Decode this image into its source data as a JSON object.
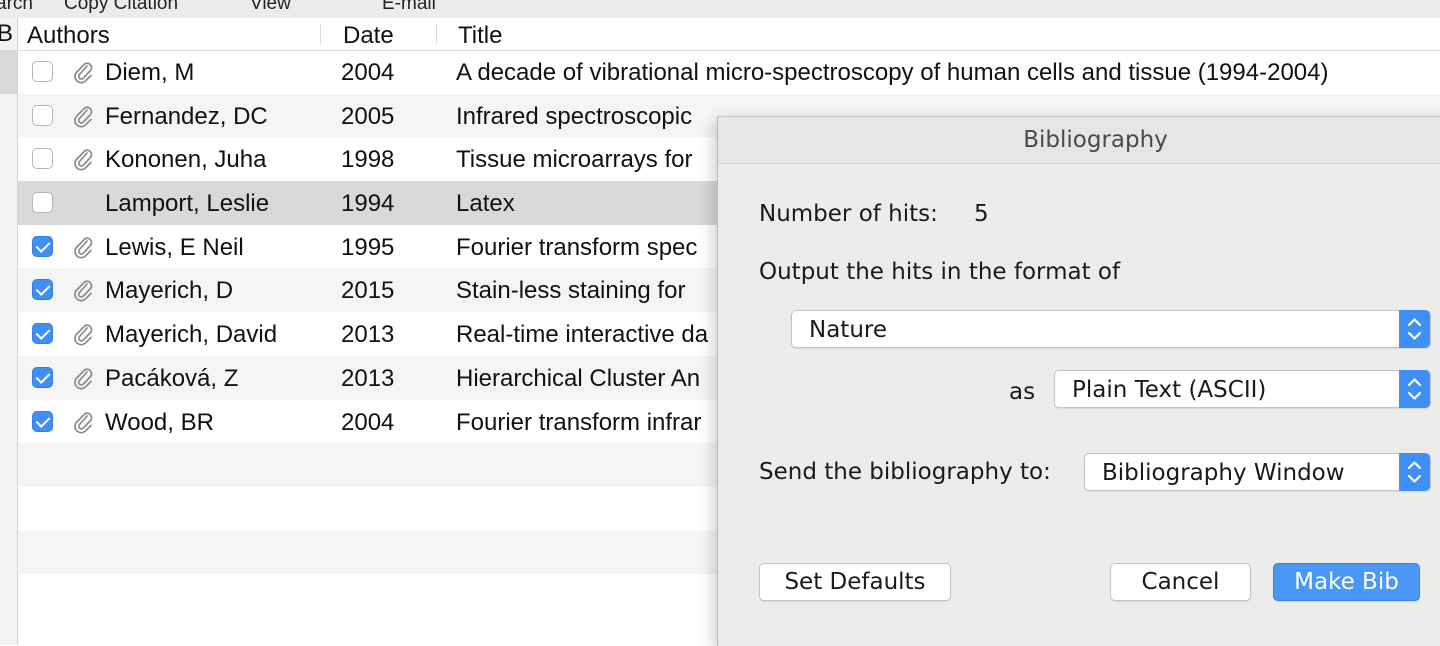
{
  "toolbar": {
    "items": [
      "arch",
      "Copy Citation",
      "View",
      "E-mail"
    ]
  },
  "table": {
    "columns": {
      "authors": "Authors",
      "date": "Date",
      "title": "Title"
    },
    "left_edge_char": "B",
    "rows": [
      {
        "checked": false,
        "attachment": true,
        "author": "Diem, M",
        "date": "2004",
        "title": "A decade of vibrational micro-spectroscopy of human cells and tissue (1994-2004)"
      },
      {
        "checked": false,
        "attachment": true,
        "author": "Fernandez, DC",
        "date": "2005",
        "title": "Infrared spectroscopic"
      },
      {
        "checked": false,
        "attachment": true,
        "author": "Kononen, Juha",
        "date": "1998",
        "title": "Tissue microarrays for"
      },
      {
        "checked": false,
        "attachment": false,
        "author": "Lamport, Leslie",
        "date": "1994",
        "title": "Latex",
        "selected": true
      },
      {
        "checked": true,
        "attachment": true,
        "author": "Lewis, E Neil",
        "date": "1995",
        "title": "Fourier transform spec"
      },
      {
        "checked": true,
        "attachment": true,
        "author": "Mayerich, D",
        "date": "2015",
        "title": "Stain-less staining for"
      },
      {
        "checked": true,
        "attachment": true,
        "author": "Mayerich, David",
        "date": "2013",
        "title": "Real-time interactive da"
      },
      {
        "checked": true,
        "attachment": true,
        "author": "Pacáková, Z",
        "date": "2013",
        "title": "Hierarchical Cluster An"
      },
      {
        "checked": true,
        "attachment": true,
        "author": "Wood, BR",
        "date": "2004",
        "title": "Fourier transform infrar"
      }
    ]
  },
  "dialog": {
    "title": "Bibliography",
    "hits_label": "Number of hits:",
    "hits_value": "5",
    "format_label": "Output the hits in the format of",
    "format_value": "Nature",
    "as_label": "as",
    "as_value": "Plain Text (ASCII)",
    "send_label": "Send the bibliography to:",
    "send_value": "Bibliography Window",
    "set_defaults": "Set Defaults",
    "cancel": "Cancel",
    "make_bib": "Make Bib"
  },
  "colors": {
    "accent": "#3f8ff5",
    "selected_row": "#d9d9d9",
    "stripe": "#f5f5f5",
    "dialog_bg": "#ececec"
  }
}
